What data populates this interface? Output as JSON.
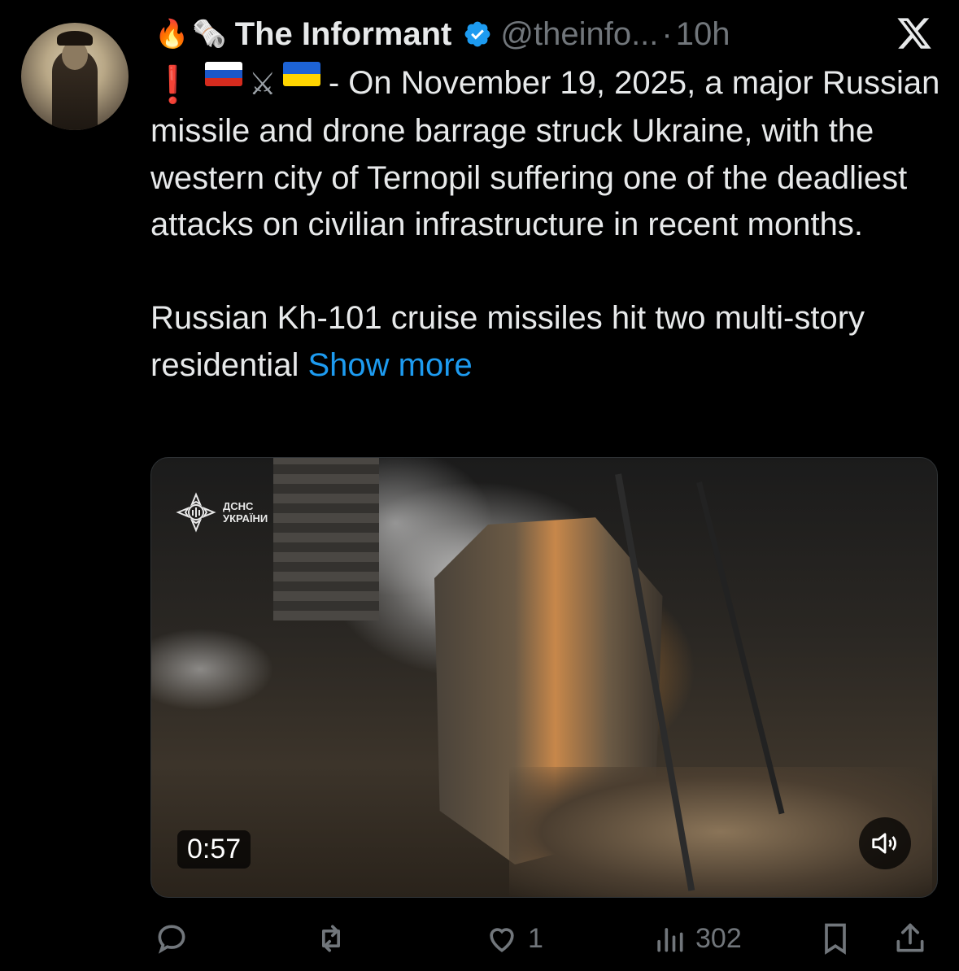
{
  "tweet": {
    "display_name": "The Informant",
    "handle": "@theinfo...",
    "separator": "·",
    "time": "10h",
    "header_emojis": [
      "🔥",
      "🗞️"
    ],
    "text_intro": "- On November 19, 2025, a major Russian missile and drone barrage struck Ukraine, with the western city of Ternopil suffering one of the deadliest attacks on civilian infrastructure in recent months.",
    "text_second": "Russian Kh-101 cruise missiles hit two multi-story residential",
    "show_more": "Show more"
  },
  "media": {
    "watermark_line1": "ДСНС",
    "watermark_line2": "УКРАЇНИ",
    "duration": "0:57"
  },
  "actions": {
    "likes": "1",
    "views": "302"
  },
  "colors": {
    "background": "#000000",
    "text": "#e7e9ea",
    "muted": "#71767b",
    "link": "#1d9bf0",
    "verified": "#1d9bf0"
  }
}
